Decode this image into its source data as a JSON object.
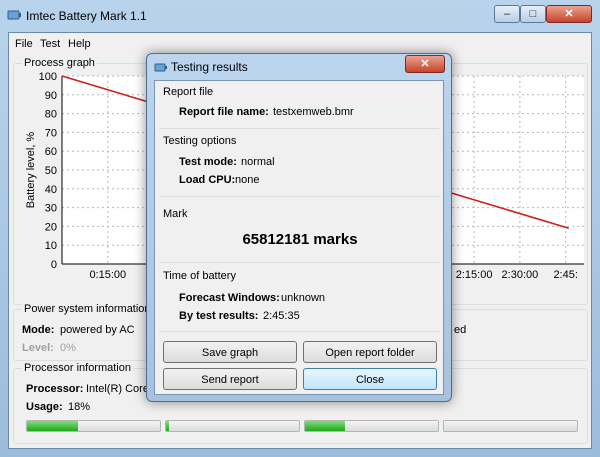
{
  "window": {
    "title": "Imtec Battery Mark 1.1",
    "caption_buttons": {
      "minimize": "‒",
      "maximize": "□",
      "close": "✕"
    }
  },
  "menu": [
    "File",
    "Test",
    "Help"
  ],
  "graph": {
    "group_title": "Process graph",
    "chart_data": {
      "type": "line",
      "ylabel": "Battery level, %",
      "ylim": [
        0,
        100
      ],
      "yticks": [
        0,
        10,
        20,
        30,
        40,
        50,
        60,
        70,
        80,
        90,
        100
      ],
      "xtick_labels": [
        "0:15:00",
        "2:15:00",
        "2:30:00",
        "2:45:"
      ],
      "series": [
        {
          "color": "#cc1f1f",
          "points": [
            [
              0,
              100
            ],
            [
              2.767,
              19
            ]
          ]
        }
      ]
    }
  },
  "power": {
    "group_title": "Power system information",
    "mode_label": "Mode:",
    "mode_value": "powered by AC",
    "level_label": "Level:",
    "level_value": "0%",
    "right_fragment": "ed"
  },
  "processor": {
    "group_title": "Processor information",
    "processor_label": "Processor:",
    "processor_value": "Intel(R) Core(",
    "usage_label": "Usage:",
    "usage_value": "18%",
    "core_loads": [
      0.38,
      0.02,
      0.3,
      0.0
    ]
  },
  "dialog": {
    "title": "Testing results",
    "close_glyph": "✕",
    "report": {
      "group_title": "Report file",
      "name_label": "Report file name:",
      "name_value": "testxemweb.bmr"
    },
    "options": {
      "group_title": "Testing options",
      "mode_label": "Test mode:",
      "mode_value": "normal",
      "cpu_label": "Load CPU:",
      "cpu_value": "none"
    },
    "mark": {
      "group_title": "Mark",
      "value": "65812181 marks"
    },
    "time": {
      "group_title": "Time of battery",
      "forecast_label": "Forecast Windows:",
      "forecast_value": "unknown",
      "test_label": "By test results:",
      "test_value": "2:45:35"
    },
    "buttons": {
      "save_graph": "Save graph",
      "open_folder": "Open report folder",
      "send_report": "Send report",
      "close": "Close"
    }
  },
  "colors": {
    "accent": "#3c7fb1",
    "line": "#cc1f1f",
    "progress": "#1fa81d"
  }
}
